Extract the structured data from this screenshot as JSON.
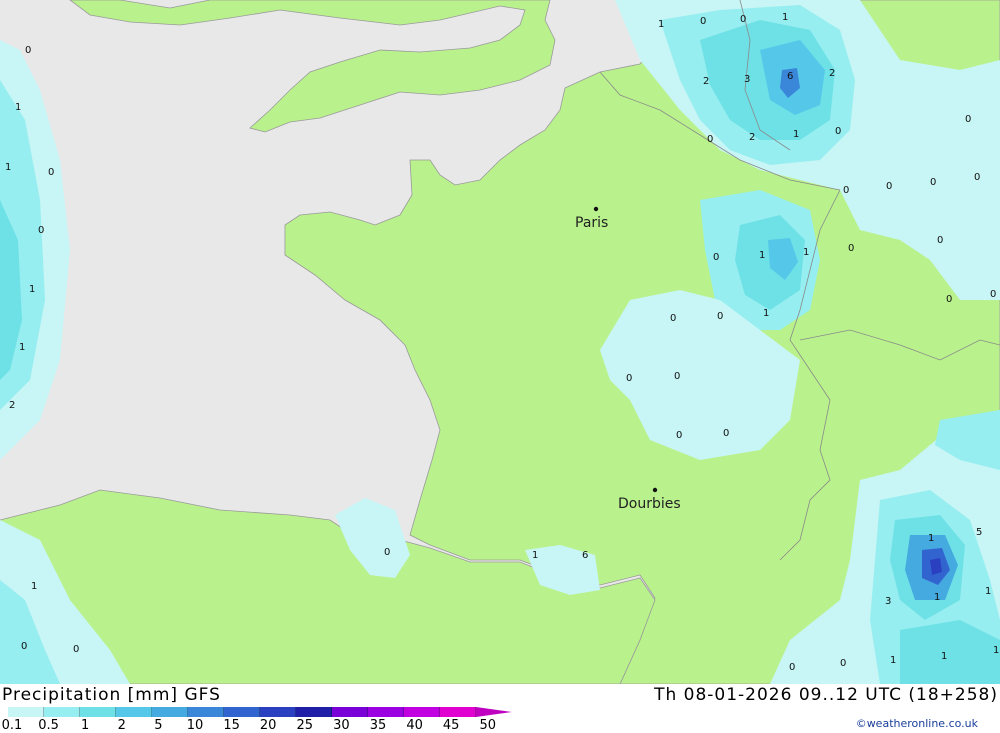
{
  "map": {
    "cities": [
      {
        "name": "Paris"
      },
      {
        "name": "Dourbies"
      }
    ],
    "contour_labels": [
      "1",
      "0",
      "0",
      "1",
      "0",
      "2",
      "3",
      "6",
      "2",
      "0",
      "2",
      "1",
      "0",
      "0",
      "0",
      "0",
      "0",
      "0",
      "1",
      "1",
      "0",
      "0",
      "1",
      "1",
      "0",
      "0",
      "0",
      "0",
      "0",
      "0",
      "1",
      "0",
      "1",
      "1",
      "0",
      "0",
      "0",
      "0",
      "2",
      "1",
      "0",
      "1",
      "6",
      "5",
      "1",
      "1",
      "1",
      "3",
      "0",
      "0",
      "1"
    ]
  },
  "title": {
    "left": "Precipitation [mm] GFS",
    "right": "Th 08-01-2026 09..12 UTC (18+258)"
  },
  "legend": {
    "ticks": [
      "0.1",
      "0.5",
      "1",
      "2",
      "5",
      "10",
      "15",
      "20",
      "25",
      "30",
      "35",
      "40",
      "45",
      "50"
    ],
    "colors": [
      "#c8f5f5",
      "#96eef0",
      "#6ee1e6",
      "#55c8ea",
      "#45aae0",
      "#3a86d8",
      "#3264d0",
      "#2a40c0",
      "#1f1fa8",
      "#7a00d8",
      "#9a00e0",
      "#c000e0",
      "#e000d0",
      "#c000c0"
    ]
  },
  "credit": "©weatheronline.co.uk"
}
